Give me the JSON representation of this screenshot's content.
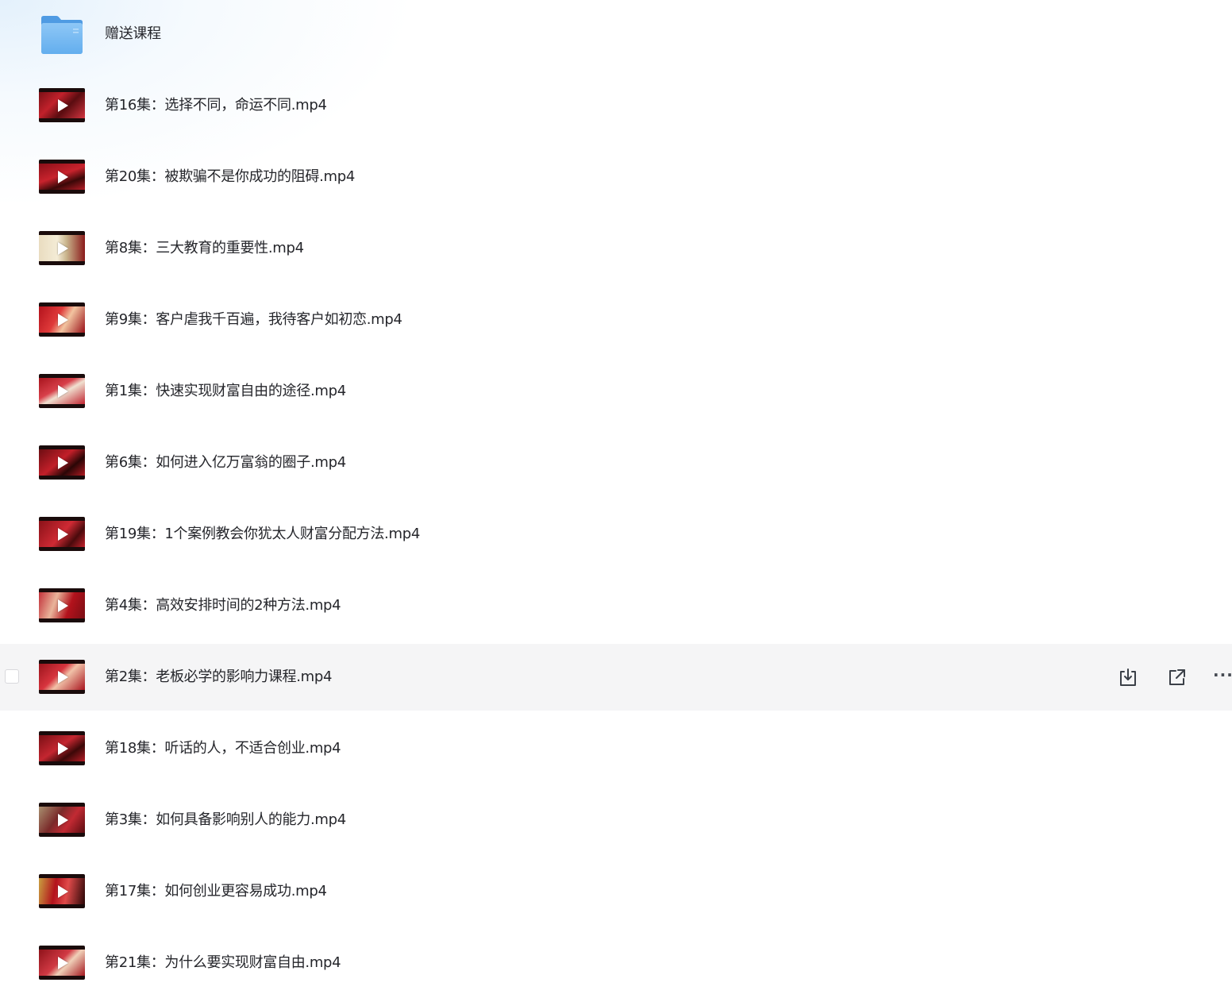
{
  "file_list": {
    "items": [
      {
        "name": "赠送课程",
        "type": "folder",
        "icon": "folder-icon",
        "hovered": false
      },
      {
        "name": "第16集：选择不同，命运不同.mp4",
        "type": "video",
        "icon": "video-thumbnail",
        "hovered": false
      },
      {
        "name": "第20集：被欺骗不是你成功的阻碍.mp4",
        "type": "video",
        "icon": "video-thumbnail",
        "hovered": false
      },
      {
        "name": "第8集：三大教育的重要性.mp4",
        "type": "video",
        "icon": "video-thumbnail",
        "hovered": false
      },
      {
        "name": "第9集：客户虐我千百遍，我待客户如初恋.mp4",
        "type": "video",
        "icon": "video-thumbnail",
        "hovered": false
      },
      {
        "name": "第1集：快速实现财富自由的途径.mp4",
        "type": "video",
        "icon": "video-thumbnail",
        "hovered": false
      },
      {
        "name": "第6集：如何进入亿万富翁的圈子.mp4",
        "type": "video",
        "icon": "video-thumbnail",
        "hovered": false
      },
      {
        "name": "第19集：1个案例教会你犹太人财富分配方法.mp4",
        "type": "video",
        "icon": "video-thumbnail",
        "hovered": false
      },
      {
        "name": "第4集：高效安排时间的2种方法.mp4",
        "type": "video",
        "icon": "video-thumbnail",
        "hovered": false
      },
      {
        "name": "第2集：老板必学的影响力课程.mp4",
        "type": "video",
        "icon": "video-thumbnail",
        "hovered": true
      },
      {
        "name": "第18集：听话的人，不适合创业.mp4",
        "type": "video",
        "icon": "video-thumbnail",
        "hovered": false
      },
      {
        "name": "第3集：如何具备影响别人的能力.mp4",
        "type": "video",
        "icon": "video-thumbnail",
        "hovered": false
      },
      {
        "name": "第17集：如何创业更容易成功.mp4",
        "type": "video",
        "icon": "video-thumbnail",
        "hovered": false
      },
      {
        "name": "第21集：为什么要实现财富自由.mp4",
        "type": "video",
        "icon": "video-thumbnail",
        "hovered": false
      }
    ]
  },
  "row_actions": {
    "download_icon": "download-icon",
    "share_icon": "share-icon",
    "more_icon": "more-icon",
    "more_glyph": "···"
  },
  "colors": {
    "text": "#25262b",
    "hover_row": "#f5f5f6",
    "folder_blue": "#6fb4f0",
    "thumbnail_red": "#b3121c"
  }
}
